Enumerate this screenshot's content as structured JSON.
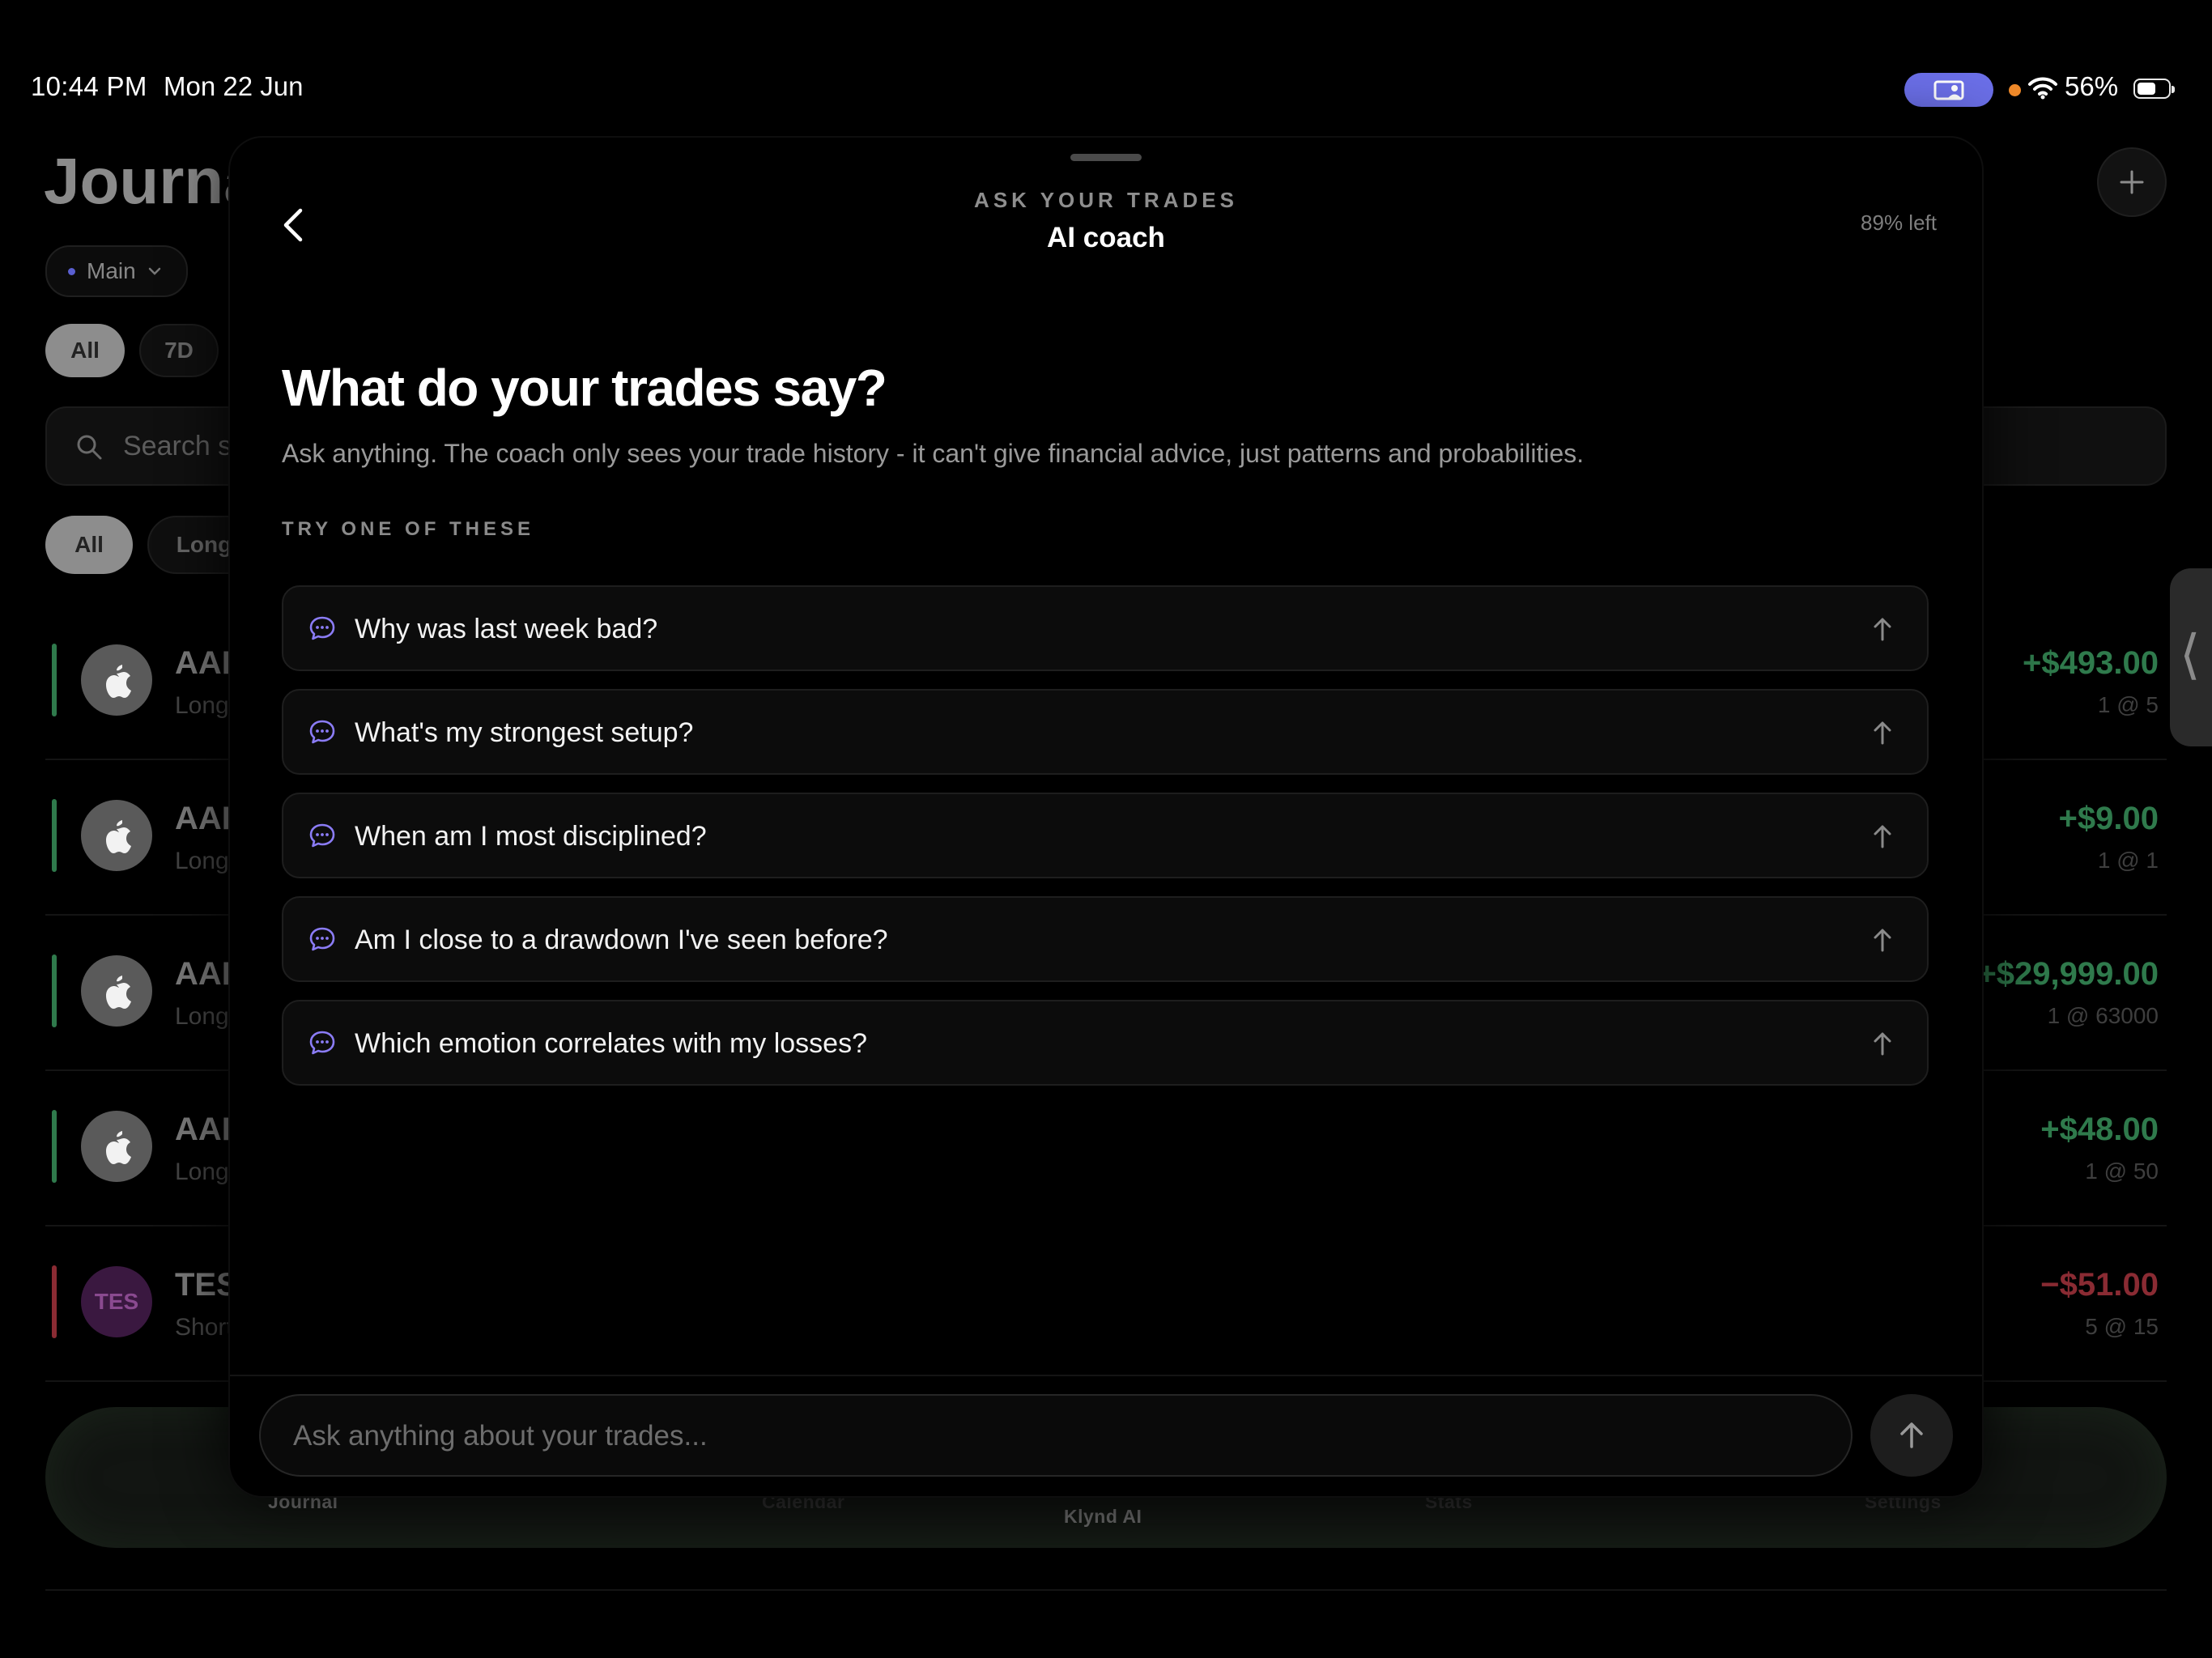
{
  "status_bar": {
    "time": "10:44 PM",
    "date": "Mon 22 Jun",
    "battery": "56%"
  },
  "journal": {
    "title": "Journal",
    "account": "Main",
    "period_filters": [
      "All",
      "7D"
    ],
    "search_placeholder": "Search symbols",
    "side_filters": [
      "All",
      "Long"
    ],
    "trades": [
      {
        "symbol": "AAPL",
        "side": "Long",
        "pnl": "+$493.00",
        "qty": "1 @ 5",
        "result": "win"
      },
      {
        "symbol": "AAPL",
        "side": "Long",
        "pnl": "+$9.00",
        "qty": "1 @ 1",
        "result": "win"
      },
      {
        "symbol": "AAPL",
        "side": "Long",
        "pnl": "+$29,999.00",
        "qty": "1 @ 63000",
        "result": "win"
      },
      {
        "symbol": "AAPL",
        "side": "Long",
        "pnl": "+$48.00",
        "qty": "1 @ 50",
        "result": "win"
      },
      {
        "symbol": "TESLA",
        "badge": "TES",
        "side": "Short",
        "pnl": "−$51.00",
        "qty": "5 @ 15",
        "result": "loss"
      }
    ],
    "tabs": [
      "Journal",
      "Calendar",
      "Klynd AI",
      "Stats",
      "Settings"
    ]
  },
  "coach": {
    "kicker": "ASK YOUR TRADES",
    "title": "AI coach",
    "quota": "89% left",
    "heading": "What do your trades say?",
    "subtitle": "Ask anything. The coach only sees your trade history - it can't give financial advice, just patterns and probabilities.",
    "try_label": "TRY ONE OF THESE",
    "suggestions": [
      "Why was last week bad?",
      "What's my strongest setup?",
      "When am I most disciplined?",
      "Am I close to a drawdown I've seen before?",
      "Which emotion correlates with my losses?"
    ],
    "input_placeholder": "Ask anything about your trades..."
  },
  "colors": {
    "accent": "#8b7cf6",
    "gain": "#2f7a4c",
    "loss": "#8a2b33",
    "screen_indicator": "#6b6fe8"
  },
  "icons": {
    "back": "chevron-left-icon",
    "suggestion": "chat-bubble-icon",
    "suggestion_action": "arrow-up-icon",
    "send": "arrow-up-icon",
    "add": "plus-icon",
    "trade_logo": "apple-logo-icon"
  }
}
